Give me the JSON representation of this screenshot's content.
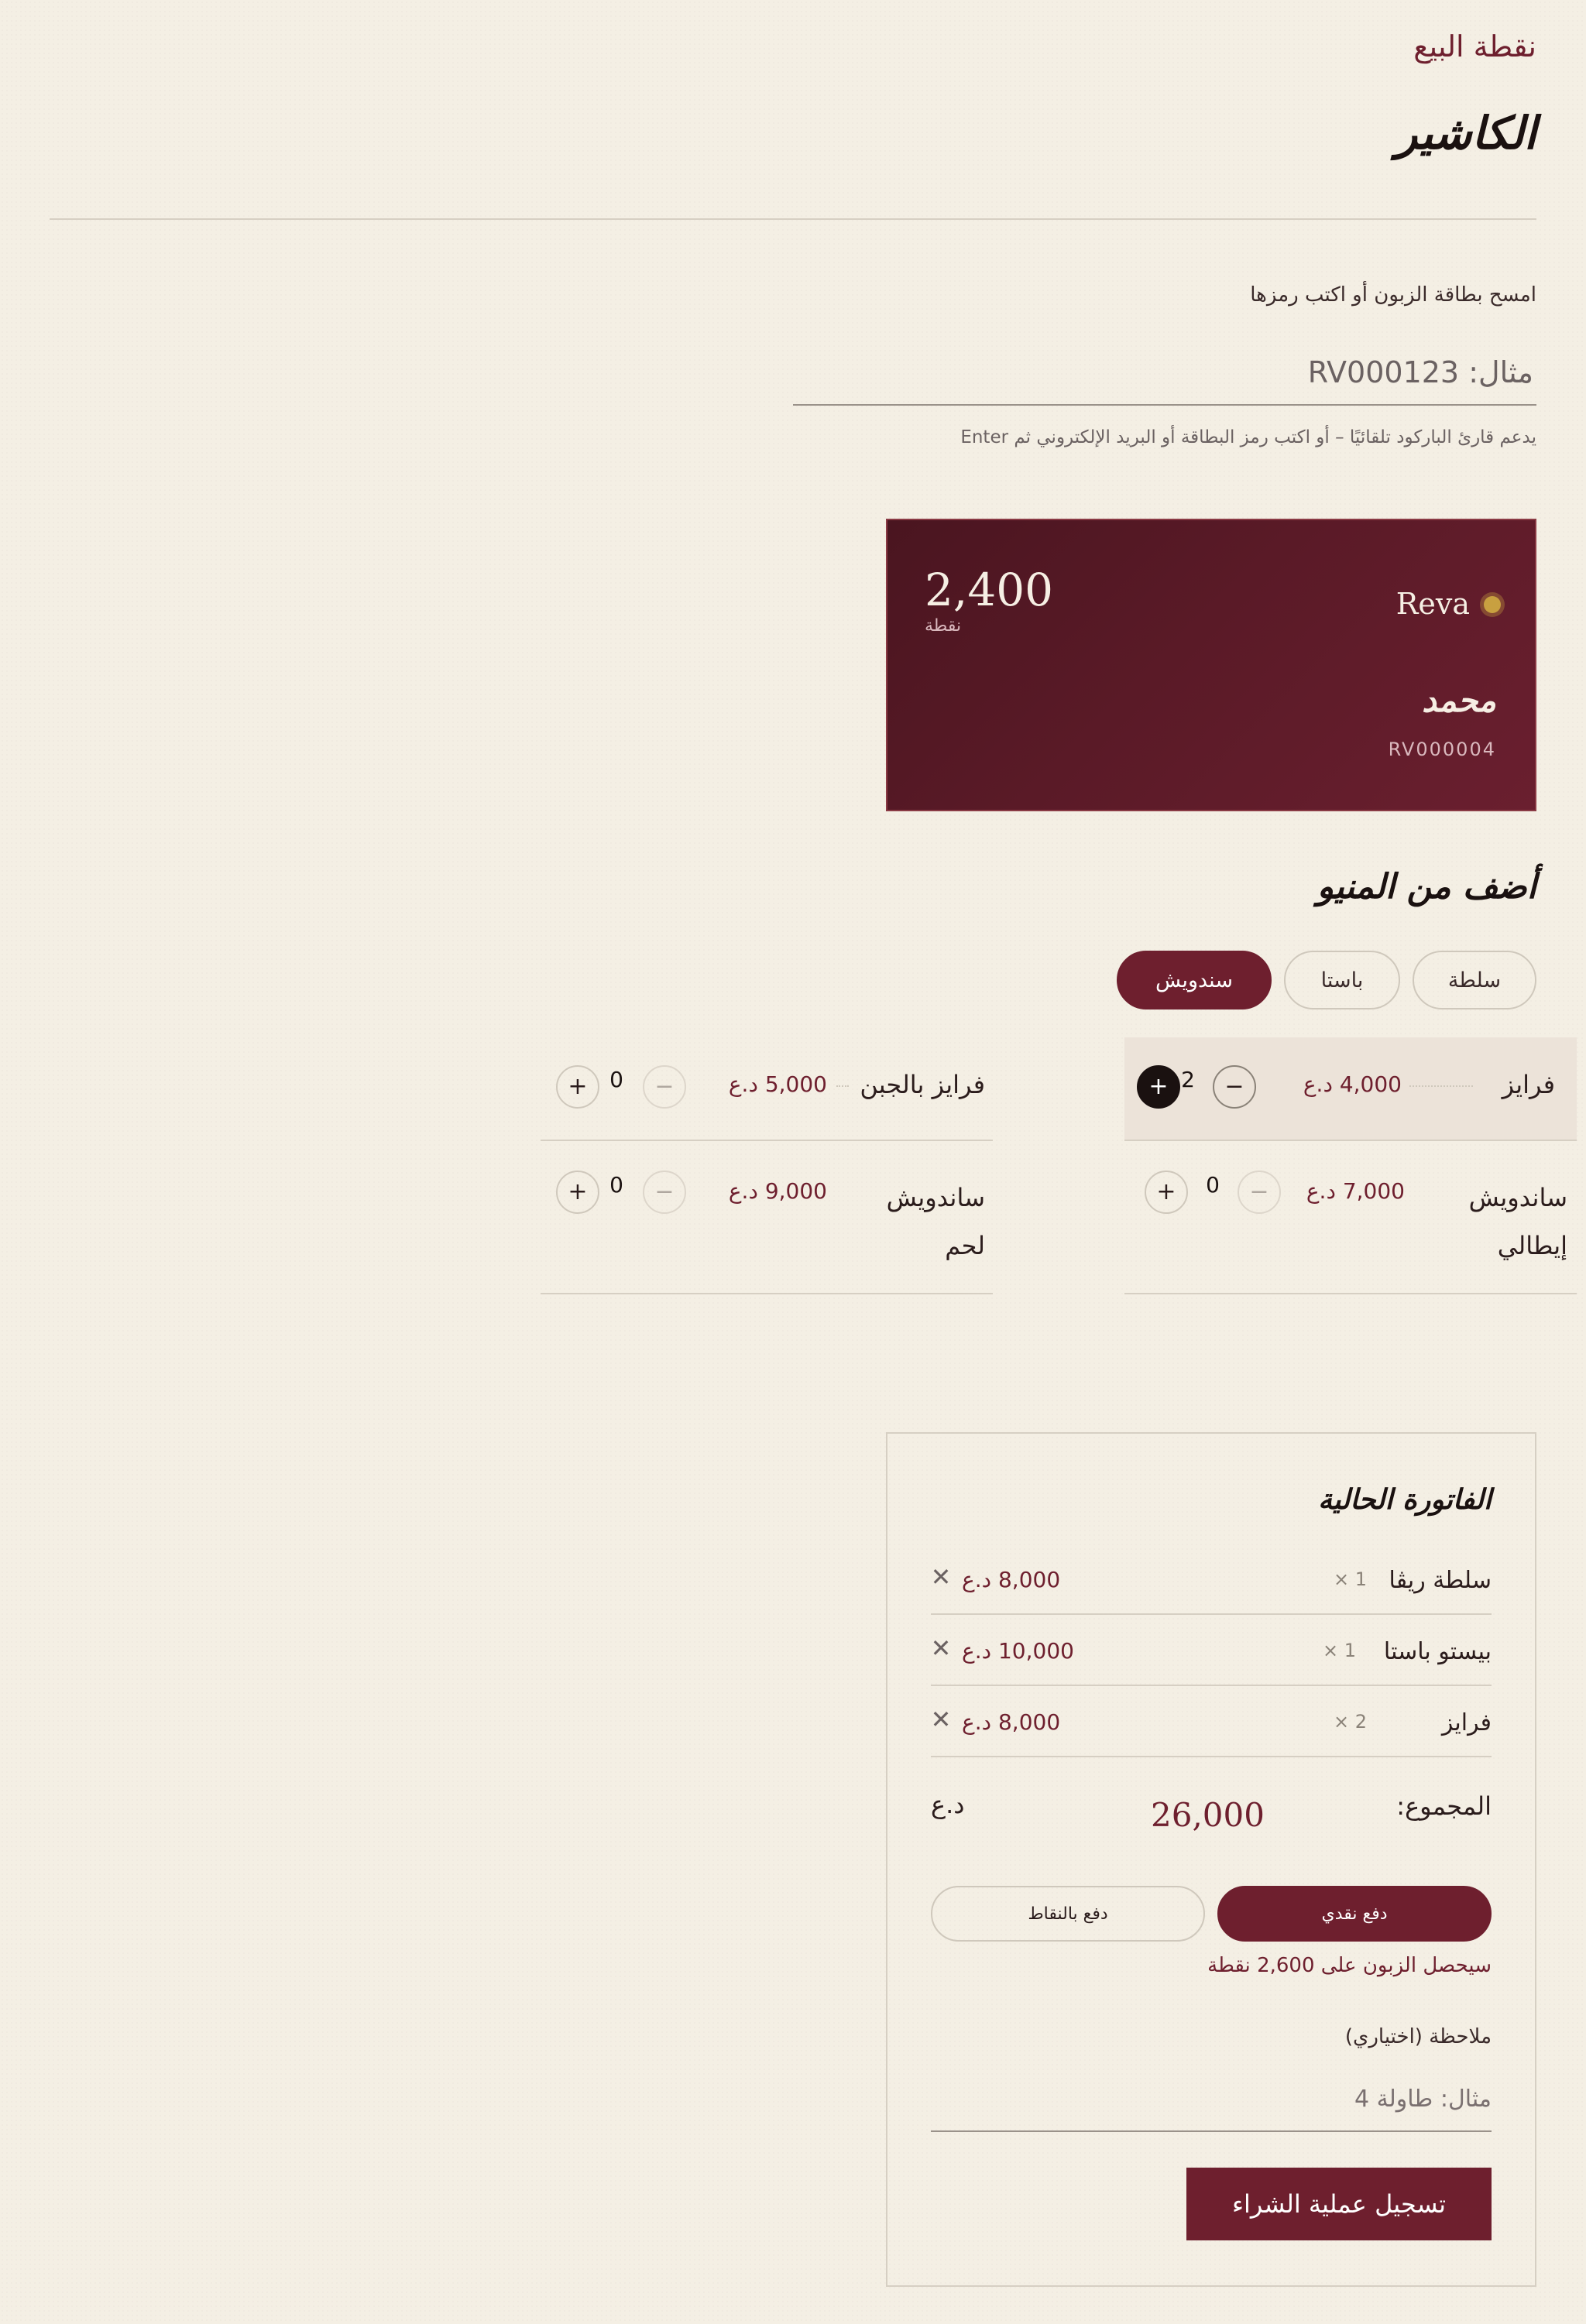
{
  "header": {
    "section_label": "نقطة البيع",
    "title": "الكاشير"
  },
  "scan": {
    "label": "امسح بطاقة الزبون أو اكتب رمزها",
    "placeholder": "مثال: RV000123",
    "hint": "يدعم قارئ الباركود تلقائيًا – أو اكتب رمز البطاقة أو البريد الإلكتروني ثم Enter"
  },
  "card": {
    "brand": "Reva",
    "points": "2,400",
    "points_label": "نقطة",
    "customer_name": "محمد",
    "code": "RV000004",
    "colors": {
      "background": "#5a1a27",
      "accent_dot": "#c8a040"
    }
  },
  "menu": {
    "title": "أضف من المنيو",
    "tabs": [
      {
        "label": "سلطة",
        "active": false
      },
      {
        "label": "باستا",
        "active": false
      },
      {
        "label": "سندويش",
        "active": true
      }
    ],
    "items": [
      {
        "name": "فرايز",
        "price": "4,000 د.ع",
        "qty": "2"
      },
      {
        "name": "فرايز بالجبن",
        "price": "5,000 د.ع",
        "qty": "0"
      },
      {
        "name": "ساندويش إيطالي",
        "price": "7,000 د.ع",
        "qty": "0"
      },
      {
        "name": "ساندويش لحم",
        "price": "9,000 د.ع",
        "qty": "0"
      }
    ],
    "minus_glyph": "−",
    "plus_glyph": "+"
  },
  "invoice": {
    "title": "الفاتورة الحالية",
    "rows": [
      {
        "name": "سلطة ريڤا",
        "qty": "× 1",
        "price": "8,000 د.ع"
      },
      {
        "name": "بيستو باستا",
        "qty": "× 1",
        "price": "10,000 د.ع"
      },
      {
        "name": "فرايز",
        "qty": "× 2",
        "price": "8,000 د.ع"
      }
    ],
    "remove_glyph": "✕",
    "total_label": "المجموع:",
    "total_value": "26,000",
    "currency": "د.ع",
    "pay_cash": "دفع نقدي",
    "pay_points": "دفع بالنقاط",
    "earn_note": "سيحصل الزبون على 2,600 نقطة",
    "note_label": "ملاحظة (اختياري)",
    "note_placeholder": "مثال: طاولة 4",
    "submit": "تسجيل عملية الشراء"
  },
  "colors": {
    "background": "#f4efe4",
    "accent": "#6e1f2e",
    "text": "#2b1c1c"
  }
}
